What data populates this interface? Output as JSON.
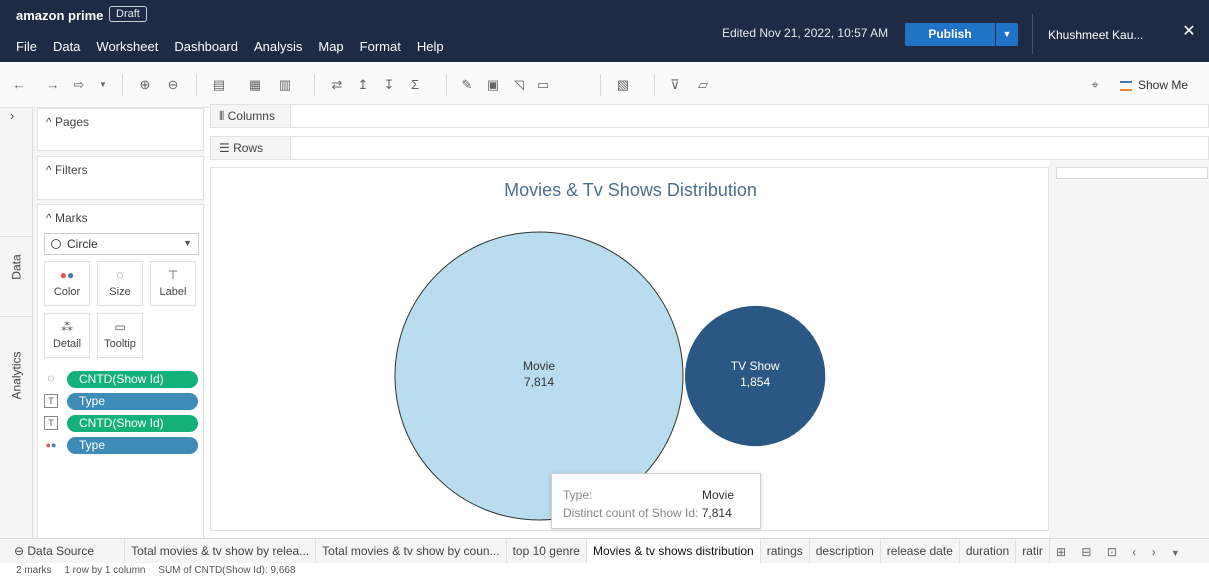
{
  "titlebar": {
    "workbook_name": "amazon prime",
    "draft_label": "Draft",
    "edited": "Edited Nov 21, 2022, 10:57 AM",
    "publish_label": "Publish",
    "user_name": "Khushmeet Kau...",
    "close_icon": "close-icon"
  },
  "menu": [
    "File",
    "Data",
    "Worksheet",
    "Dashboard",
    "Analysis",
    "Map",
    "Format",
    "Help"
  ],
  "toolbar": {
    "show_me_label": "Show Me"
  },
  "side_tabs": {
    "data": "Data",
    "analytics": "Analytics"
  },
  "cards": {
    "pages": "Pages",
    "filters": "Filters",
    "marks": "Marks",
    "mark_type": "Circle",
    "buttons": {
      "color": "Color",
      "size": "Size",
      "label": "Label",
      "detail": "Detail",
      "tooltip": "Tooltip"
    },
    "pills": [
      {
        "field": "CNTD(Show Id)",
        "encoding": "size"
      },
      {
        "field": "Type",
        "encoding": "label"
      },
      {
        "field": "CNTD(Show Id)",
        "encoding": "label"
      },
      {
        "field": "Type",
        "encoding": "color"
      }
    ]
  },
  "shelves": {
    "columns": "Columns",
    "rows": "Rows"
  },
  "chart_data": {
    "type": "bubble",
    "title": "Movies & Tv Shows Distribution",
    "categories": [
      "Movie",
      "TV Show"
    ],
    "values": [
      7814,
      1854
    ],
    "value_labels": [
      "7,814",
      "1,854"
    ],
    "colors": [
      "#b9dcee",
      "#2a5783"
    ],
    "label_colors": [
      "#333333",
      "#ffffff"
    ]
  },
  "tooltip": {
    "type_label": "Type:",
    "type_value": "Movie",
    "count_label": "Distinct count of Show Id:",
    "count_value": "7,814"
  },
  "sheet_tabs": {
    "data_source": "Data Source",
    "tabs": [
      "Total movies & tv show by relea...",
      "Total movies & tv show by coun...",
      "top 10 genre",
      "Movies & tv shows distribution",
      "ratings",
      "description",
      "release date",
      "duration",
      "ratir"
    ],
    "active_index": 3
  },
  "statusbar": {
    "marks": "2 marks",
    "dims": "1 row by 1 column",
    "sum": "SUM of CNTD(Show Id): 9,668"
  }
}
